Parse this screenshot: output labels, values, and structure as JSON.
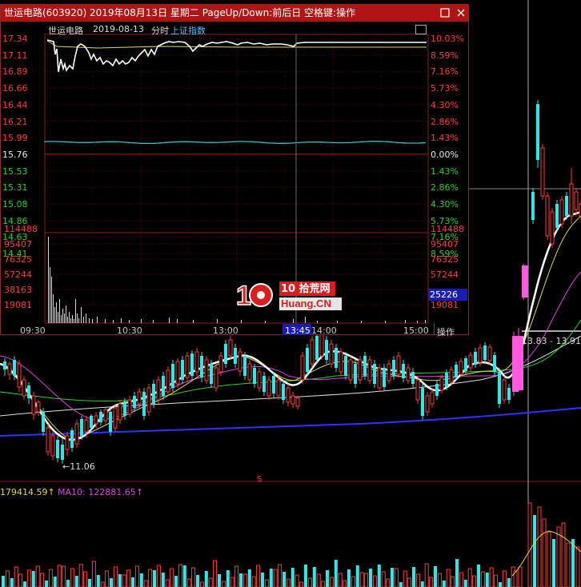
{
  "window": {
    "title": "世运电路(603920)  2019年08月13日  星期二  PageUp/Down:前后日  空格键:操作",
    "min_icon": "minimize-icon",
    "close_icon": "close-icon"
  },
  "intraday": {
    "stock_name": "世运电路",
    "date": "2019-08-13",
    "mode": "分时",
    "index_link": "上证指数",
    "price_labels": [
      "17.34",
      "17.11",
      "16.89",
      "16.66",
      "16.44",
      "16.21",
      "15.99",
      "15.76",
      "15.53",
      "15.31",
      "15.08",
      "14.86",
      "14.63",
      "14.41"
    ],
    "pct_labels": [
      "10.03%",
      "8.59%",
      "7.16%",
      "5.73%",
      "4.30%",
      "2.86%",
      "1.43%",
      "0.00%",
      "1.43%",
      "2.86%",
      "4.30%",
      "5.73%",
      "7.16%",
      "8.59%"
    ],
    "vol_labels": [
      "114488",
      "95407",
      "76325",
      "57244",
      "38163",
      "19081"
    ],
    "vol_labels_right": [
      "114488",
      "95407",
      "76325",
      "57244",
      "25226",
      "19081"
    ],
    "current_volume": "25226",
    "time_labels": [
      "09:30",
      "10:30",
      "13:00",
      "14:00",
      "15:00"
    ],
    "cursor_time": "13:45",
    "operate_label": "操作",
    "colors": {
      "up": "#ff3c3c",
      "down": "#2ecf2e",
      "neutral": "#ffffff",
      "price_line": "#ffffff",
      "avg_line": "#e6d84a",
      "cursor_bg": "#1c1cb4"
    }
  },
  "watermark": {
    "brand": "10 拾荒网",
    "domain": "Huang.CN"
  },
  "kline": {
    "low_marker": "←11.06",
    "range_label": "13.83 - 13.91",
    "s_marker": "S",
    "vol_ma_text": "179414.59↑",
    "ma10_text": "MA10: 122881.65↑"
  }
}
